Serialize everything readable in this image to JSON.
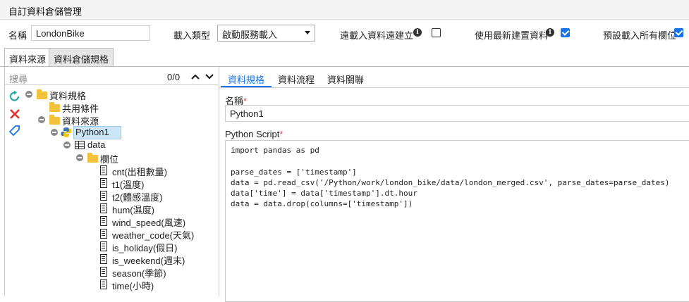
{
  "window": {
    "title": "自訂資料倉儲管理"
  },
  "form": {
    "name_label": "名稱",
    "name_value": "LondonBike",
    "load_type_label": "載入類型",
    "load_type_value": "啟動服務載入",
    "remote_load_label": "遠載入資料遠建立",
    "remote_load_checked": false,
    "use_latest_label": "使用最新建置資料",
    "use_latest_checked": true,
    "load_all_label": "預設載入所有欄位",
    "load_all_checked": true
  },
  "tabs": [
    {
      "label": "資料來源",
      "active": false
    },
    {
      "label": "資料倉儲規格",
      "active": true
    }
  ],
  "search": {
    "placeholder": "搜尋",
    "count": "0/0"
  },
  "tree": {
    "root": "資料規格",
    "shared": "共用條件",
    "source": "資料來源",
    "python": "Python1",
    "data": "data",
    "fields": "欄位",
    "columns": [
      "cnt(出租數量)",
      "t1(溫度)",
      "t2(體感溫度)",
      "hum(濕度)",
      "wind_speed(風速)",
      "weather_code(天氣)",
      "is_holiday(假日)",
      "is_weekend(週末)",
      "season(季節)",
      "time(小時)"
    ]
  },
  "right_tabs": [
    {
      "label": "資料規格",
      "active": true
    },
    {
      "label": "資料流程",
      "active": false
    },
    {
      "label": "資料關聯",
      "active": false
    }
  ],
  "detail": {
    "name_label": "名稱",
    "name_value": "Python1",
    "script_label": "Python Script",
    "script": "import pandas as pd\n\nparse_dates = ['timestamp']\ndata = pd.read_csv('/Python/work/london_bike/data/london_merged.csv', parse_dates=parse_dates)\ndata['time'] = data['timestamp'].dt.hour\ndata = data.drop(columns=['timestamp'])"
  }
}
